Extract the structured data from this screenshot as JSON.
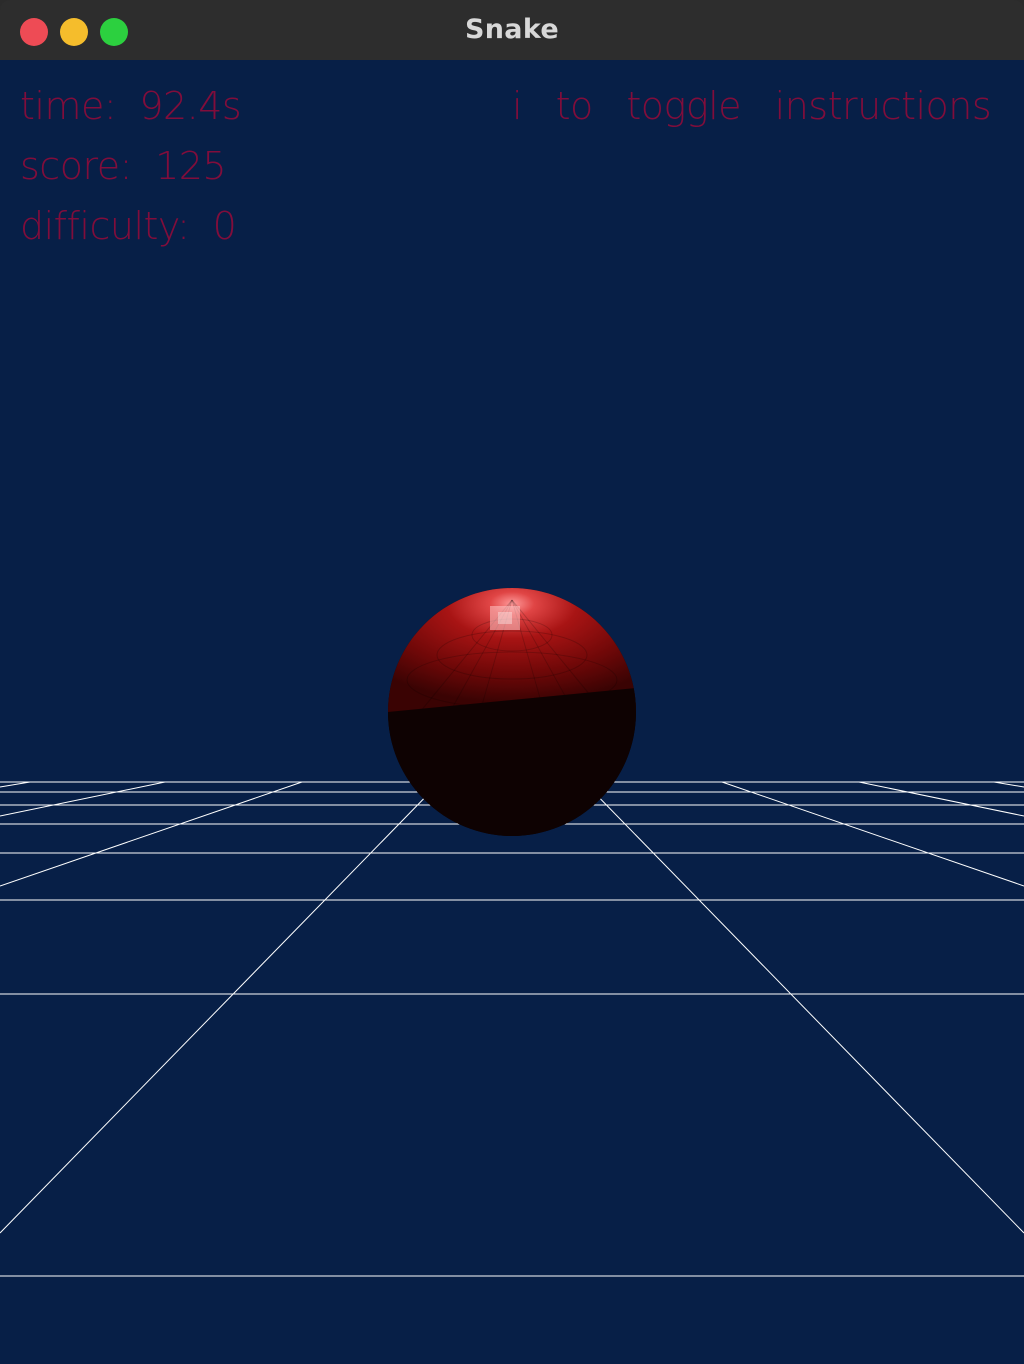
{
  "window": {
    "title": "Snake"
  },
  "hud": {
    "time": "time:  92.4s",
    "score": "score:  125",
    "difficulty": "difficulty:  0",
    "toggle_hint": "i to toggle instructions"
  },
  "colors": {
    "background": "#071f47",
    "hud_text": "#8c0c3a",
    "grid": "#ffffff",
    "sphere": "#b01010"
  }
}
